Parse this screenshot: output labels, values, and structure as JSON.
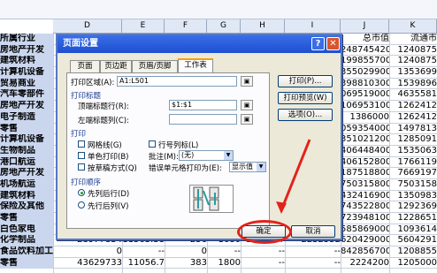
{
  "formula_cell": "",
  "col_headers": [
    "D",
    "E",
    "F",
    "G",
    "H",
    "I",
    "J",
    "K"
  ],
  "grid": {
    "rows": [
      {
        "a": "所属行业",
        "j": "总市值",
        "k": "流通市"
      },
      {
        "a": "房地产开发",
        "j": "248745420",
        "k": "1240875"
      },
      {
        "a": "建筑材料",
        "j": "199855700",
        "k": "1240875"
      },
      {
        "a": "计算机设备",
        "j": "355029900",
        "k": "1353699"
      },
      {
        "a": "贸易商业",
        "j": "398810300",
        "k": "1539896"
      },
      {
        "a": "汽车零部件",
        "j": "069519000",
        "k": "4635581"
      },
      {
        "a": "房地产开发",
        "j": "1069531000",
        "k": "1262412"
      },
      {
        "a": "电子制造",
        "j": "1386000",
        "k": "1262412"
      },
      {
        "a": "零售",
        "j": "059354000",
        "k": "1497813"
      },
      {
        "a": "计算机设备",
        "j": "351021200",
        "k": "1285091"
      },
      {
        "a": "生物制品",
        "j": "406448400",
        "k": "1535063"
      },
      {
        "a": "港口航运",
        "j": "406152800",
        "k": "1766119"
      },
      {
        "a": "房地产开发",
        "j": "187518800",
        "k": "7669197"
      },
      {
        "a": "机场航运",
        "j": "750315800",
        "k": "7503158"
      },
      {
        "a": "建筑材料",
        "j": "432416900",
        "k": "1350983"
      },
      {
        "a": "保险及其他",
        "j": "743522800",
        "k": "1292369"
      },
      {
        "a": "零售",
        "j": "723948100",
        "k": "1228651"
      },
      {
        "a": "白色家电",
        "j": "585869000",
        "k": "1093614"
      },
      {
        "a": "化学制品",
        "b": "28977834",
        "c": "11563.38",
        "d": "256",
        "e": "1680",
        "f": "1976957",
        "g": "2232552",
        "j": "620429000",
        "k": "5604291"
      },
      {
        "a": "食品饮料加工",
        "b": "0",
        "c": "--",
        "d": "0",
        "e": "--",
        "f": "--",
        "g": "--",
        "j": "842856700",
        "k": "1208855"
      },
      {
        "a": "零售",
        "b": "43629733",
        "c": "11056.7",
        "d": "383",
        "e": "1800",
        "f": "--",
        "g": "--",
        "j": "2224200",
        "k": "1205000"
      }
    ]
  },
  "dialog": {
    "title": "页面设置",
    "help_label": "?",
    "close_label": "✕",
    "tabs": [
      "页面",
      "页边距",
      "页眉/页脚",
      "工作表"
    ],
    "print_area_label": "打印区域(A):",
    "print_area_value": "A1:L501",
    "print_titles_label": "打印标题",
    "top_rows_label": "顶端标题行(R):",
    "top_rows_value": "$1:$1",
    "left_cols_label": "左端标题列(C):",
    "left_cols_value": "",
    "print_group": "打印",
    "gridlines": "网格线(G)",
    "row_col_headers": "行号列标(L)",
    "mono": "单色打印(B)",
    "comments_label": "批注(M):",
    "comments_value": "(无)",
    "draft": "按草稿方式(Q)",
    "errors_label": "错误单元格打印为(E):",
    "errors_value": "显示值",
    "order_group": "打印顺序",
    "order1": "先列后行(D)",
    "order2": "先行后列(V)",
    "print_btn": "打印(P)...",
    "preview_btn": "打印预览(W)",
    "options_btn": "选项(O)...",
    "ok_btn": "确定",
    "cancel_btn": "取消"
  },
  "annotation_color": "#e3221c"
}
